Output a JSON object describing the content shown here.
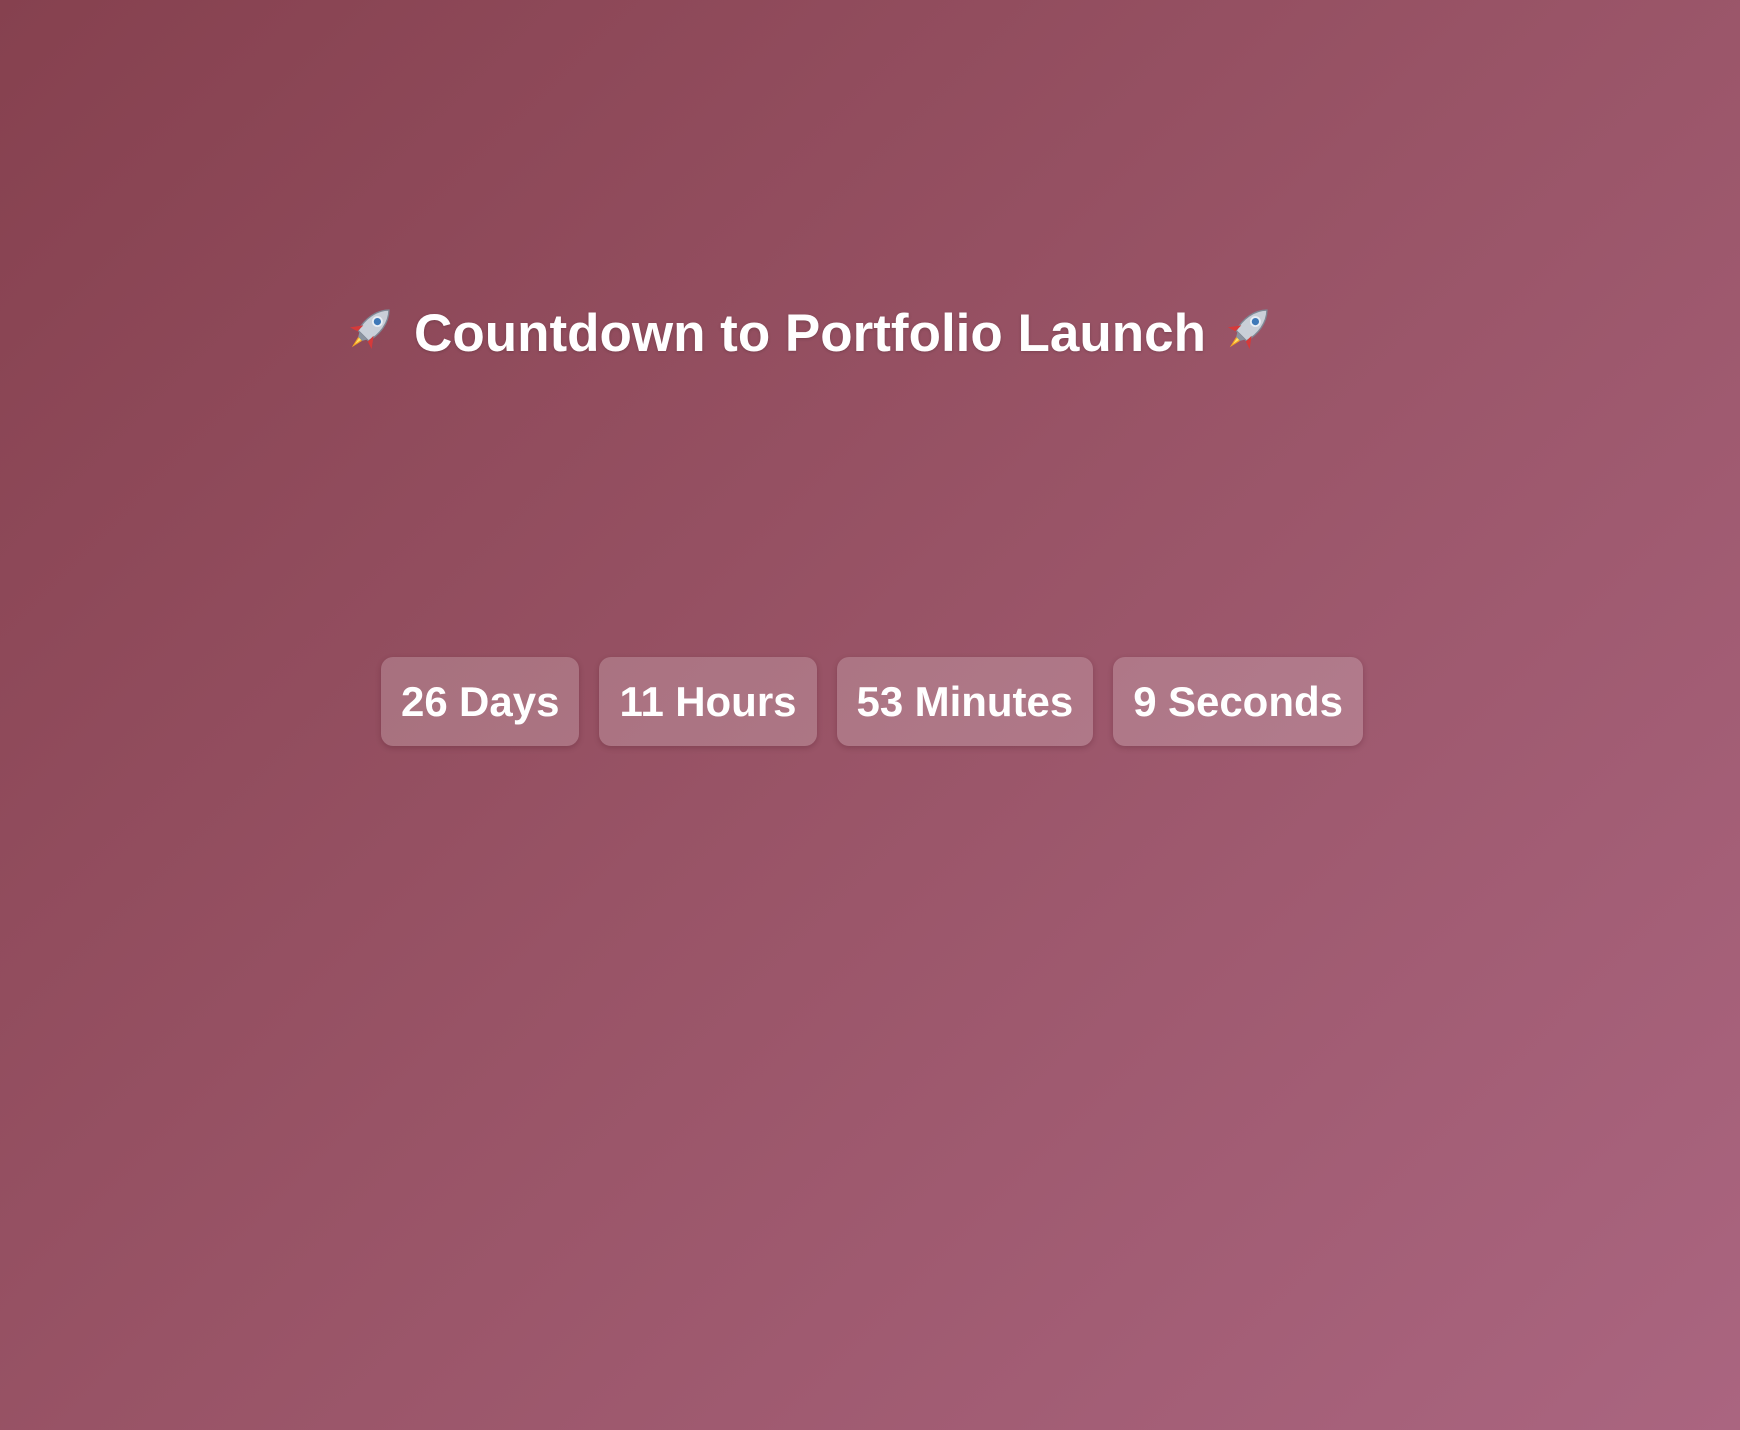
{
  "header": {
    "title": "Countdown to Portfolio Launch",
    "left_icon": "rocket-icon",
    "right_icon": "rocket-icon"
  },
  "countdown": {
    "days": {
      "value": "26",
      "unit": "Days"
    },
    "hours": {
      "value": "11",
      "unit": "Hours"
    },
    "minutes": {
      "value": "53",
      "unit": "Minutes"
    },
    "seconds": {
      "value": "9",
      "unit": "Seconds"
    }
  },
  "colors": {
    "background_start": "#86414f",
    "background_end": "#aa6580",
    "text": "#ffffff"
  }
}
